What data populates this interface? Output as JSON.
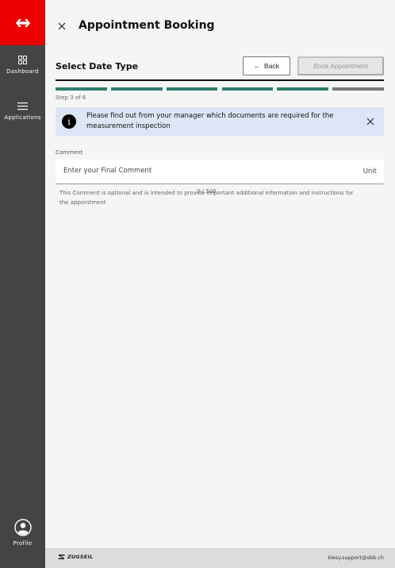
{
  "sidebar": {
    "items": [
      {
        "label": "Dashboard",
        "icon": "dashboard-grid-icon"
      },
      {
        "label": "Applications",
        "icon": "hamburger-menu-icon"
      }
    ],
    "profile": {
      "label": "Profile",
      "icon": "user-circle-icon"
    }
  },
  "header": {
    "title": "Appointment Booking"
  },
  "section": {
    "title": "Select Date Type",
    "back_label": "Back",
    "book_label": "Book Appointment",
    "step_text": "Step 3 of 6"
  },
  "stepper": {
    "current": 3,
    "total": 6,
    "completed_color": "#2e7d6b",
    "pending_color": "#777777"
  },
  "info": {
    "message": "Please find out from your manager which documents are required for the measurement inspection"
  },
  "comment": {
    "label": "Comment",
    "placeholder": "Enter your Final Comment",
    "unit": "Unit",
    "helper": "This Comment is optional and is intended to provide important additional information and instructions for the appointment",
    "count": "0 / 500"
  },
  "footer": {
    "brand": "ZUGSEIL",
    "email": "klesy.support@sbb.ch"
  },
  "colors": {
    "brand_red": "#eb0000",
    "sidebar": "#444444",
    "info_bg": "#dde6f7"
  }
}
